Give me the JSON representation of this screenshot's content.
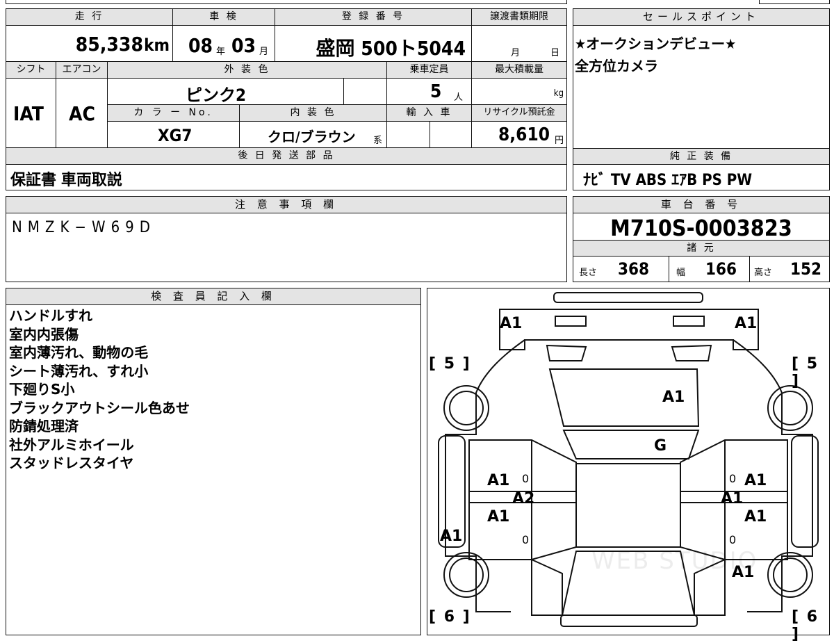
{
  "top_table": {
    "mileage_label": "走 行",
    "mileage_value": "85,338",
    "mileage_unit": "km",
    "inspection_label": "車 検",
    "inspection_year": "08",
    "inspection_year_unit": "年",
    "inspection_month": "03",
    "inspection_month_unit": "月",
    "registration_label": "登 録 番 号",
    "registration_value": "盛岡 500ト5044",
    "transfer_label": "譲渡書類期限",
    "transfer_month_unit": "月",
    "transfer_day_unit": "日",
    "shift_label": "シフト",
    "shift_value": "IAT",
    "ac_label": "エアコン",
    "ac_value": "AC",
    "exterior_label": "外 装 色",
    "exterior_value": "ピンク2",
    "capacity_label": "乗車定員",
    "capacity_value": "5",
    "capacity_unit": "人",
    "maxload_label": "最大積載量",
    "maxload_unit": "kg",
    "color_no_label": "カ ラ ー No.",
    "color_no_value": "XG7",
    "interior_label": "内 装 色",
    "interior_value": "クロ/ブラウン",
    "interior_suffix": "系",
    "import_label": "輸 入 車",
    "recycle_label": "リサイクル預託金",
    "recycle_value": "8,610",
    "recycle_unit": "円"
  },
  "later_parts": {
    "label": "後 日 発 送 部 品",
    "value": "保証書 車両取説"
  },
  "sales_point": {
    "label": "セールスポイント",
    "lines": [
      "★オークションデビュー★",
      "全方位カメラ"
    ]
  },
  "genuine_equipment": {
    "label": "純 正 装 備",
    "value": "ﾅﾋﾞ TV ABS ｴｱB PS PW"
  },
  "notes": {
    "label": "注 意 事 項 欄",
    "value": "NMZK−W69D"
  },
  "chassis": {
    "label": "車 台 番 号",
    "value": "M710S-0003823"
  },
  "specs": {
    "label": "諸 元",
    "length_label": "長さ",
    "length_value": "368",
    "width_label": "幅",
    "width_value": "166",
    "height_label": "高さ",
    "height_value": "152"
  },
  "inspector": {
    "label": "検 査 員 記 入 欄",
    "lines": [
      "ハンドルすれ",
      "室内内張傷",
      "室内薄汚れ、動物の毛",
      "シート薄汚れ、すれ小",
      "下廻りS小",
      "ブラックアウトシール色あせ",
      "防錆処理済",
      "社外アルミホイール",
      "スタッドレスタイヤ"
    ]
  },
  "diagram": {
    "tire_front_left": "[ 5 ]",
    "tire_front_right": "[ 5 ]",
    "tire_rear_left": "[ 6 ]",
    "tire_rear_right": "[ 6 ]",
    "marks": {
      "front_left": "A1",
      "front_right": "A1",
      "hood": "A1",
      "windshield": "G",
      "left_front_door": "A1",
      "left_rear_door": "A1",
      "left_center": "A2",
      "left_side": "A1",
      "right_front_door": "A1",
      "right_rear_door": "A1",
      "right_center": "A1",
      "right_rear": "A1",
      "zero": "0"
    },
    "watermark": "WEB STUDIO"
  }
}
